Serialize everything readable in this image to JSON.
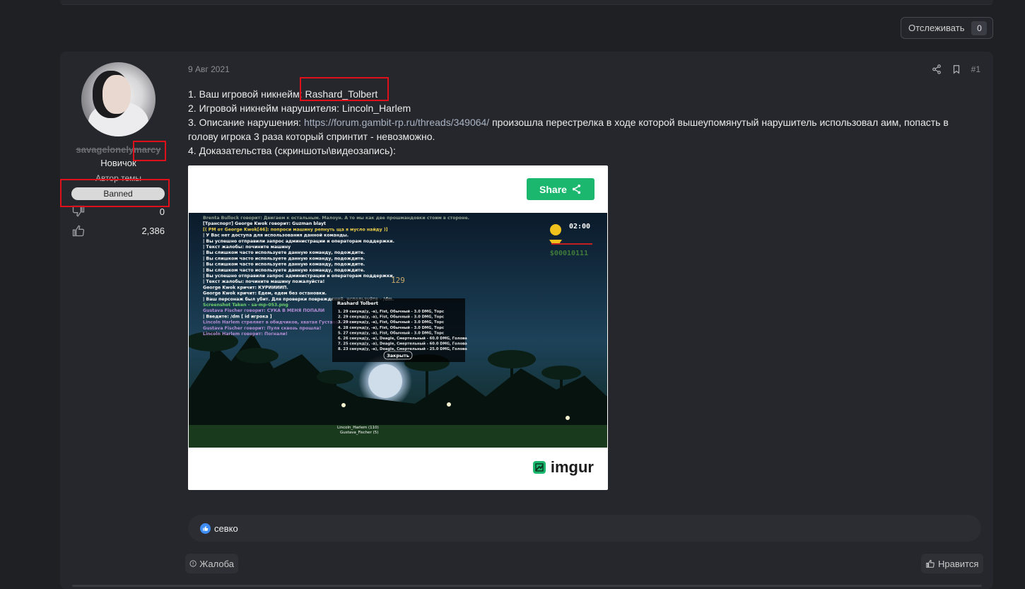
{
  "topbar": {
    "watch_label": "Отслеживать",
    "watch_count": "0"
  },
  "user": {
    "name": "savagelonelymarcy",
    "title": "Новичок",
    "thread_author": "Автор темы",
    "badge": "Banned",
    "stats": [
      {
        "icon": "dislike-icon",
        "value": "0"
      },
      {
        "icon": "like-icon",
        "value": "2,386"
      }
    ]
  },
  "post": {
    "date": "9 Авг 2021",
    "number": "#1",
    "lines": {
      "l1_label": "1. Ваш игровой никнейм: ",
      "l1_value": "Rashard_Tolbert",
      "l2": "2. Игровой никнейм нарушителя: Lincoln_Harlem",
      "l3_label": "3. Описание нарушения: ",
      "l3_link": "https://forum.gambit-rp.ru/threads/349064/",
      "l3_text": " произошла перестрелка в ходе которой вышеупомянутый нарушитель использовал аим, попасть в голову игрока 3 раза который спринтит - невозможно.",
      "l4": "4. Доказательства (скриншоты\\видеозапись):"
    },
    "embed": {
      "share_label": "Share",
      "brand": "imgur",
      "game": {
        "timer": "02:00",
        "money": "$00010111",
        "counter": "129",
        "chat": [
          "Brenta Bullock говорит: Двигаем к остальным. Малоун. А то мы как две прошмандовки стоим в стороне.",
          "[Транспорт] George Kwok говорит: Guzman blayt",
          "[( PM от George Kwok[46]: попроси машину репнуть ща я мусло найду )]",
          "| У Вас нет доступа для использования данной команды.",
          "| Вы успешно отправили запрос администрации и операторам поддержки.",
          "| Текст жалобы: почините машину",
          "| Вы слишком часто используете данную команду, подождите.",
          "| Вы слишком часто используете данную команду, подождите.",
          "| Вы слишком часто используете данную команду, подождите.",
          "| Вы слишком часто используете данную команду, подождите.",
          "| Вы успешно отправили запрос администрации и операторам поддержки.",
          "| Текст жалобы: почините машину пожалуйста!",
          "George Kwok кричит: КУРИИИИП.",
          "George Kwok кричит: Едем, едем без остановки.",
          "| Ваш персонаж был убит. Для проверки повреждений, используйте - /dm.",
          "Screenshot Taken - sa-mp-053.png",
          "Gustava Fischer говорит: СУКА В МЕНЯ ПОПАЛИ",
          "| Введите: /dm [ id игрока ]",
          "Lincoln Harlem стреляет в обидчиков, хватая Густава, бежит",
          "Gustava Fischer говорит: Пуля сквозь прошла!",
          "Lincoln Harlem говорит: Погнали!"
        ],
        "dialog": {
          "title": "Rashard Tolbert",
          "rows": [
            "1. 29 секунд(у, -а), Fist, Обычный - 3.0 DMG, Торс",
            "2. 29 секунд(у, -а), Fist, Обычный - 3.0 DMG, Торс",
            "3. 29 секунд(у, -а), Fist, Обычный - 3.0 DMG, Торс",
            "4. 28 секунд(у, -а), Fist, Обычный - 3.0 DMG, Торс",
            "5. 27 секунд(у, -а), Fist, Обычный - 3.0 DMG, Торс",
            "6. 26 секунд(у, -а), Deagle, Смертельный - 60.0 DMG, Голова",
            "7. 25 секунд(у, -а), Deagle, Смертельный - 60.0 DMG, Голова",
            "8. 23 секунд(у, -а), Deagle, Смертельный - 25.0 DMG, Голова"
          ],
          "close_label": "Закрыть"
        },
        "nametags": [
          "Lincoln_Harlem (110)",
          "Gustava_Fischer (5)"
        ]
      }
    }
  },
  "reactions": {
    "names": "севко"
  },
  "footer": {
    "report_label": "Жалоба",
    "like_label": "Нравится"
  },
  "colors": {
    "background": "#1f2024",
    "panel": "#26272c",
    "share": "#1bb76e",
    "highlight": "#e0101a"
  }
}
